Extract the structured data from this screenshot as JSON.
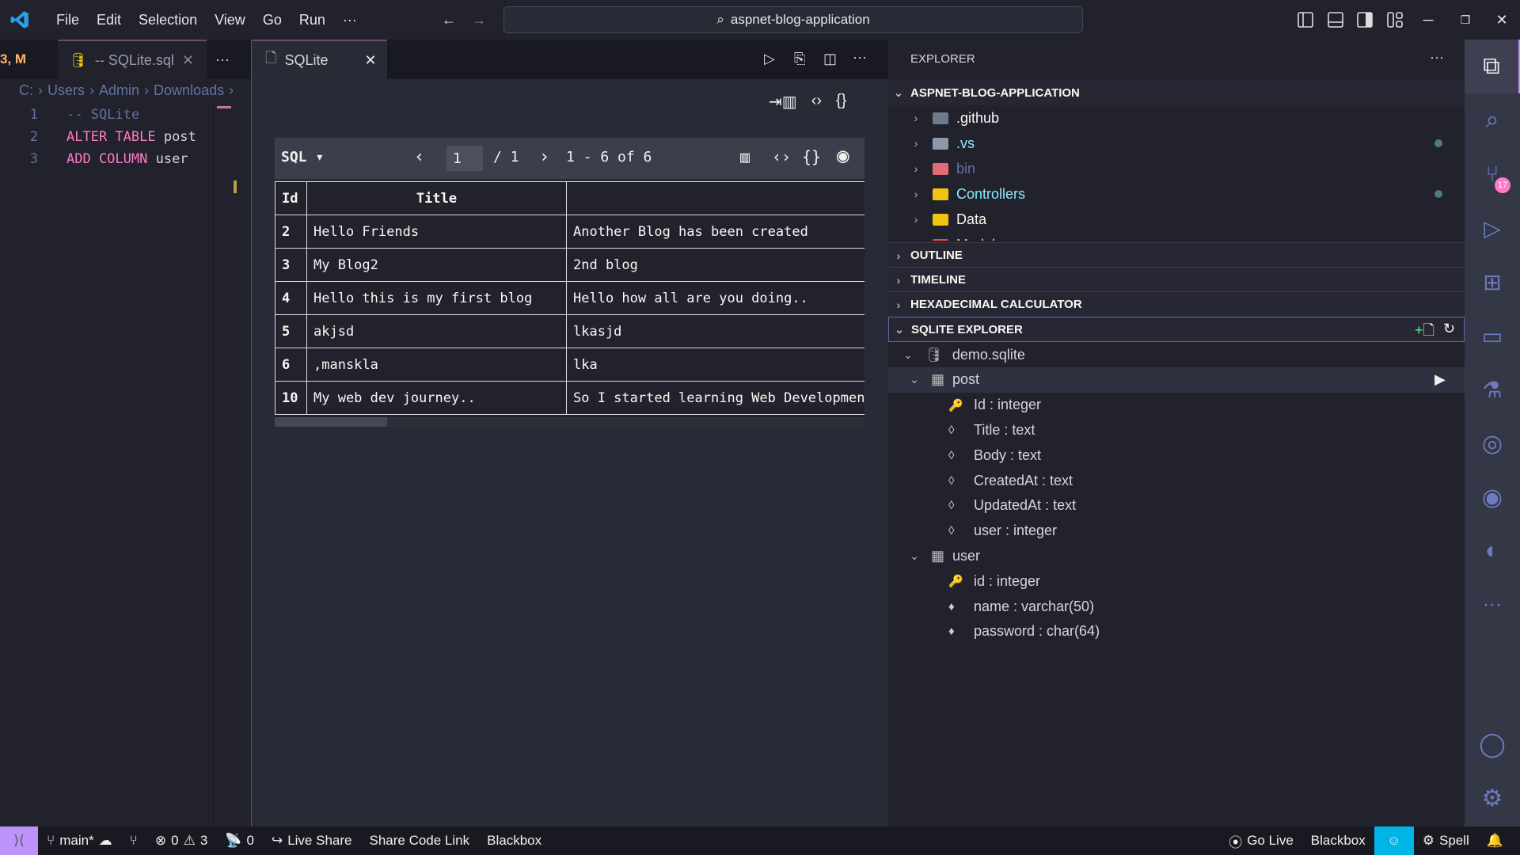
{
  "titlebar": {
    "menu": [
      "File",
      "Edit",
      "Selection",
      "View",
      "Go",
      "Run",
      "···"
    ],
    "search": "aspnet-blog-application"
  },
  "tabs": {
    "left_partial": "3, M",
    "sql_file": "-- SQLite.sql",
    "more": "···",
    "results": "SQLite"
  },
  "breadcrumb": [
    "C:",
    "Users",
    "Admin",
    "Downloads"
  ],
  "code": [
    {
      "n": "1",
      "parts": [
        {
          "t": "-- SQLite",
          "c": "cm"
        }
      ]
    },
    {
      "n": "2",
      "parts": [
        {
          "t": "ALTER TABLE ",
          "c": "kw"
        },
        {
          "t": "post",
          "c": ""
        }
      ]
    },
    {
      "n": "3",
      "parts": [
        {
          "t": "ADD COLUMN ",
          "c": "kw"
        },
        {
          "t": "user",
          "c": ""
        }
      ]
    }
  ],
  "results": {
    "lang": "SQL ▾",
    "page": "1",
    "of_pages": "/ 1",
    "range": "1 - 6 of 6",
    "columns": [
      "Id",
      "Title",
      ""
    ],
    "rows": [
      [
        "2",
        "Hello Friends",
        "Another Blog has been created"
      ],
      [
        "3",
        "My Blog2",
        "2nd blog"
      ],
      [
        "4",
        "Hello this is my first blog",
        "Hello how all are you doing.."
      ],
      [
        "5",
        "akjsd",
        "lkasjd"
      ],
      [
        "6",
        ",manskla",
        "lka"
      ],
      [
        "10",
        "My web dev journey..",
        "So I started learning Web Development"
      ]
    ]
  },
  "explorer": {
    "title": "EXPLORER",
    "root": "ASPNET-BLOG-APPLICATION",
    "items": [
      {
        "name": ".github",
        "color": "#f8f8f2",
        "icon": "#6c7a89"
      },
      {
        "name": ".vs",
        "color": "#8be9fd",
        "icon": "#8a9aa8"
      },
      {
        "name": "bin",
        "color": "#6272a4",
        "icon": "#e06c75"
      },
      {
        "name": "Controllers",
        "color": "#8be9fd",
        "icon": "#f1c40f"
      },
      {
        "name": "Data",
        "color": "#f8f8f2",
        "icon": "#f1c40f"
      },
      {
        "name": "Models",
        "color": "#ffb86c",
        "icon": "#e74c3c"
      }
    ],
    "sections": [
      "OUTLINE",
      "TIMELINE",
      "HEXADECIMAL CALCULATOR",
      "SQLITE EXPLORER"
    ]
  },
  "sqlite": {
    "db": "demo.sqlite",
    "tables": [
      {
        "name": "post",
        "cols": [
          {
            "t": "Id : integer",
            "k": "key"
          },
          {
            "t": "Title : text",
            "k": "o"
          },
          {
            "t": "Body : text",
            "k": "o"
          },
          {
            "t": "CreatedAt : text",
            "k": "o"
          },
          {
            "t": "UpdatedAt : text",
            "k": "o"
          },
          {
            "t": "user : integer",
            "k": "o"
          }
        ]
      },
      {
        "name": "user",
        "cols": [
          {
            "t": "id : integer",
            "k": "key"
          },
          {
            "t": "name : varchar(50)",
            "k": "f"
          },
          {
            "t": "password : char(64)",
            "k": "f"
          }
        ]
      }
    ]
  },
  "activity": {
    "badge": "17"
  },
  "status": {
    "branch": "main*",
    "errors": "0",
    "warnings": "3",
    "ports": "0",
    "live_share": "Live Share",
    "share_code": "Share Code Link",
    "blackbox_left": "Blackbox",
    "go_live": "Go Live",
    "blackbox_right": "Blackbox",
    "spell": "Spell"
  },
  "colors": {
    "accent": "#bd93f9",
    "copilot": "#00b4e6",
    "badge": "#ff79c6"
  }
}
